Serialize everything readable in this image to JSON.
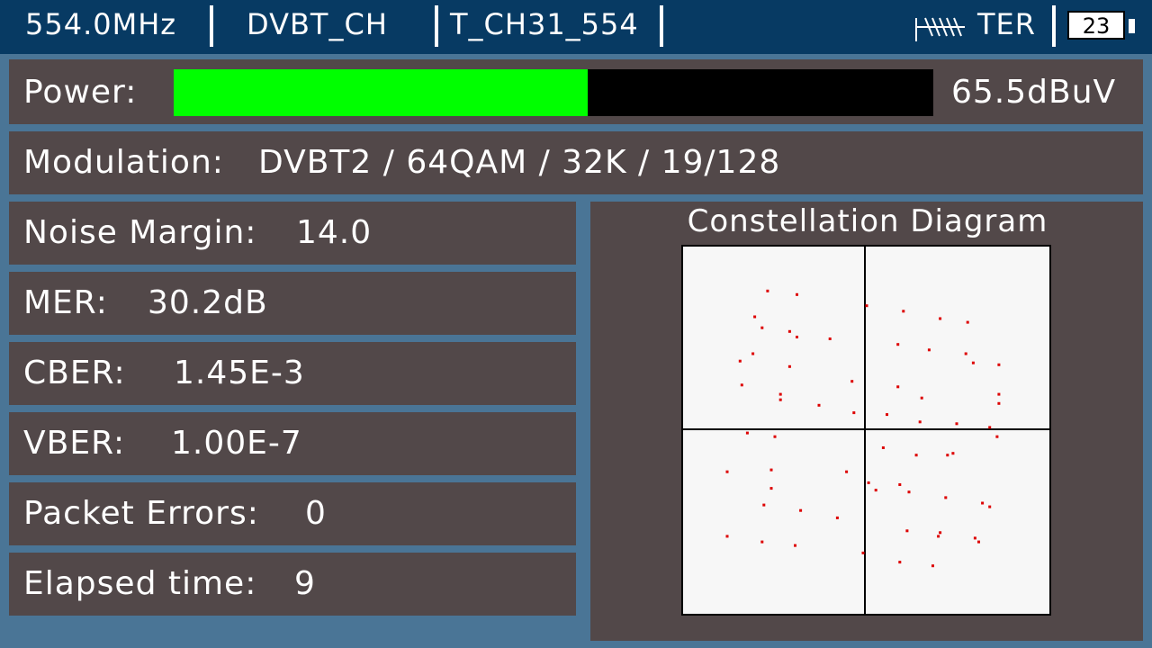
{
  "topbar": {
    "frequency": "554.0MHz",
    "channel_table": "DVBT_CH",
    "channel": "T_CH31_554",
    "band": "TER",
    "battery_level": "23",
    "antenna_icon": "antenna-icon"
  },
  "power": {
    "label": "Power:",
    "value": "65.5dBuV",
    "level_fraction": 0.545,
    "fill_color": "#00ff00"
  },
  "modulation": {
    "label": "Modulation:",
    "value": "DVBT2 / 64QAM / 32K / 19/128"
  },
  "measurements": [
    {
      "label": "Noise Margin:",
      "value": "14.0"
    },
    {
      "label": "MER:",
      "value": "30.2dB"
    },
    {
      "label": "CBER:",
      "value": "1.45E-3"
    },
    {
      "label": "VBER:",
      "value": "1.00E-7"
    },
    {
      "label": "Packet Errors:",
      "value": "0"
    },
    {
      "label": "Elapsed time:",
      "value": "9"
    }
  ],
  "constellation": {
    "title": "Constellation Diagram",
    "point_color": "#dd0000"
  },
  "chart_data": {
    "type": "scatter",
    "title": "Constellation Diagram",
    "xlim": [
      -1,
      1
    ],
    "ylim": [
      -1,
      1
    ],
    "points": [
      [
        -0.53,
        0.75
      ],
      [
        -0.37,
        0.73
      ],
      [
        -0.6,
        0.61
      ],
      [
        -0.56,
        0.55
      ],
      [
        -0.41,
        0.53
      ],
      [
        -0.37,
        0.5
      ],
      [
        -0.19,
        0.49
      ],
      [
        -0.61,
        0.41
      ],
      [
        -0.68,
        0.37
      ],
      [
        -0.41,
        0.34
      ],
      [
        -0.67,
        0.24
      ],
      [
        -0.46,
        0.19
      ],
      [
        -0.07,
        0.26
      ],
      [
        -0.25,
        0.13
      ],
      [
        -0.46,
        0.16
      ],
      [
        -0.06,
        0.09
      ],
      [
        0.01,
        0.67
      ],
      [
        0.21,
        0.64
      ],
      [
        0.41,
        0.6
      ],
      [
        0.56,
        0.58
      ],
      [
        0.18,
        0.46
      ],
      [
        0.35,
        0.43
      ],
      [
        0.55,
        0.41
      ],
      [
        0.59,
        0.36
      ],
      [
        0.73,
        0.35
      ],
      [
        0.18,
        0.23
      ],
      [
        0.31,
        0.17
      ],
      [
        0.73,
        0.19
      ],
      [
        0.73,
        0.14
      ],
      [
        0.12,
        0.08
      ],
      [
        0.3,
        0.04
      ],
      [
        0.5,
        0.03
      ],
      [
        -0.64,
        -0.02
      ],
      [
        -0.49,
        -0.04
      ],
      [
        -0.75,
        -0.23
      ],
      [
        -0.51,
        -0.22
      ],
      [
        -0.1,
        -0.23
      ],
      [
        -0.51,
        -0.32
      ],
      [
        -0.55,
        -0.41
      ],
      [
        -0.35,
        -0.44
      ],
      [
        -0.15,
        -0.48
      ],
      [
        -0.75,
        -0.58
      ],
      [
        -0.56,
        -0.61
      ],
      [
        -0.38,
        -0.63
      ],
      [
        -0.01,
        -0.67
      ],
      [
        0.02,
        -0.29
      ],
      [
        0.06,
        -0.33
      ],
      [
        0.1,
        -0.1
      ],
      [
        0.28,
        -0.14
      ],
      [
        0.45,
        -0.14
      ],
      [
        0.24,
        -0.34
      ],
      [
        0.44,
        -0.37
      ],
      [
        0.64,
        -0.4
      ],
      [
        0.68,
        -0.42
      ],
      [
        0.23,
        -0.55
      ],
      [
        0.4,
        -0.58
      ],
      [
        0.6,
        -0.59
      ],
      [
        0.62,
        -0.61
      ],
      [
        0.19,
        -0.72
      ],
      [
        0.37,
        -0.74
      ],
      [
        0.68,
        0.01
      ],
      [
        0.72,
        -0.04
      ],
      [
        0.48,
        -0.13
      ],
      [
        0.19,
        -0.3
      ],
      [
        0.41,
        -0.56
      ]
    ]
  }
}
